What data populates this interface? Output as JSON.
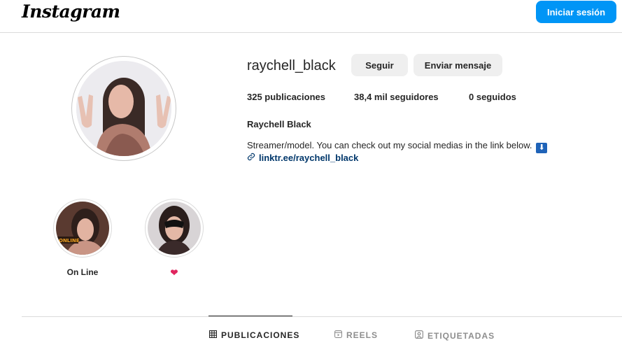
{
  "header": {
    "logo_text": "Instagram",
    "login_label": "Iniciar sesión"
  },
  "profile": {
    "username": "raychell_black",
    "follow_label": "Seguir",
    "message_label": "Enviar mensaje",
    "stats": {
      "posts": "325 publicaciones",
      "followers": "38,4 mil seguidores",
      "following": "0 seguidos"
    },
    "full_name": "Raychell Black",
    "bio": "Streamer/model. You can check out my social medias in the link below.",
    "bio_emoji": "⬇",
    "link": "linktr.ee/raychell_black"
  },
  "highlights": [
    {
      "label": "On Line",
      "overlay_text": "ONLINE"
    },
    {
      "label": "❤"
    }
  ],
  "tabs": [
    {
      "label": "PUBLICACIONES",
      "icon": "grid-icon",
      "active": true
    },
    {
      "label": "REELS",
      "icon": "reels-icon",
      "active": false
    },
    {
      "label": "ETIQUETADAS",
      "icon": "tagged-icon",
      "active": false
    }
  ],
  "colors": {
    "primary_button": "#0095f6",
    "link": "#00376b",
    "secondary_button": "#efefef"
  }
}
